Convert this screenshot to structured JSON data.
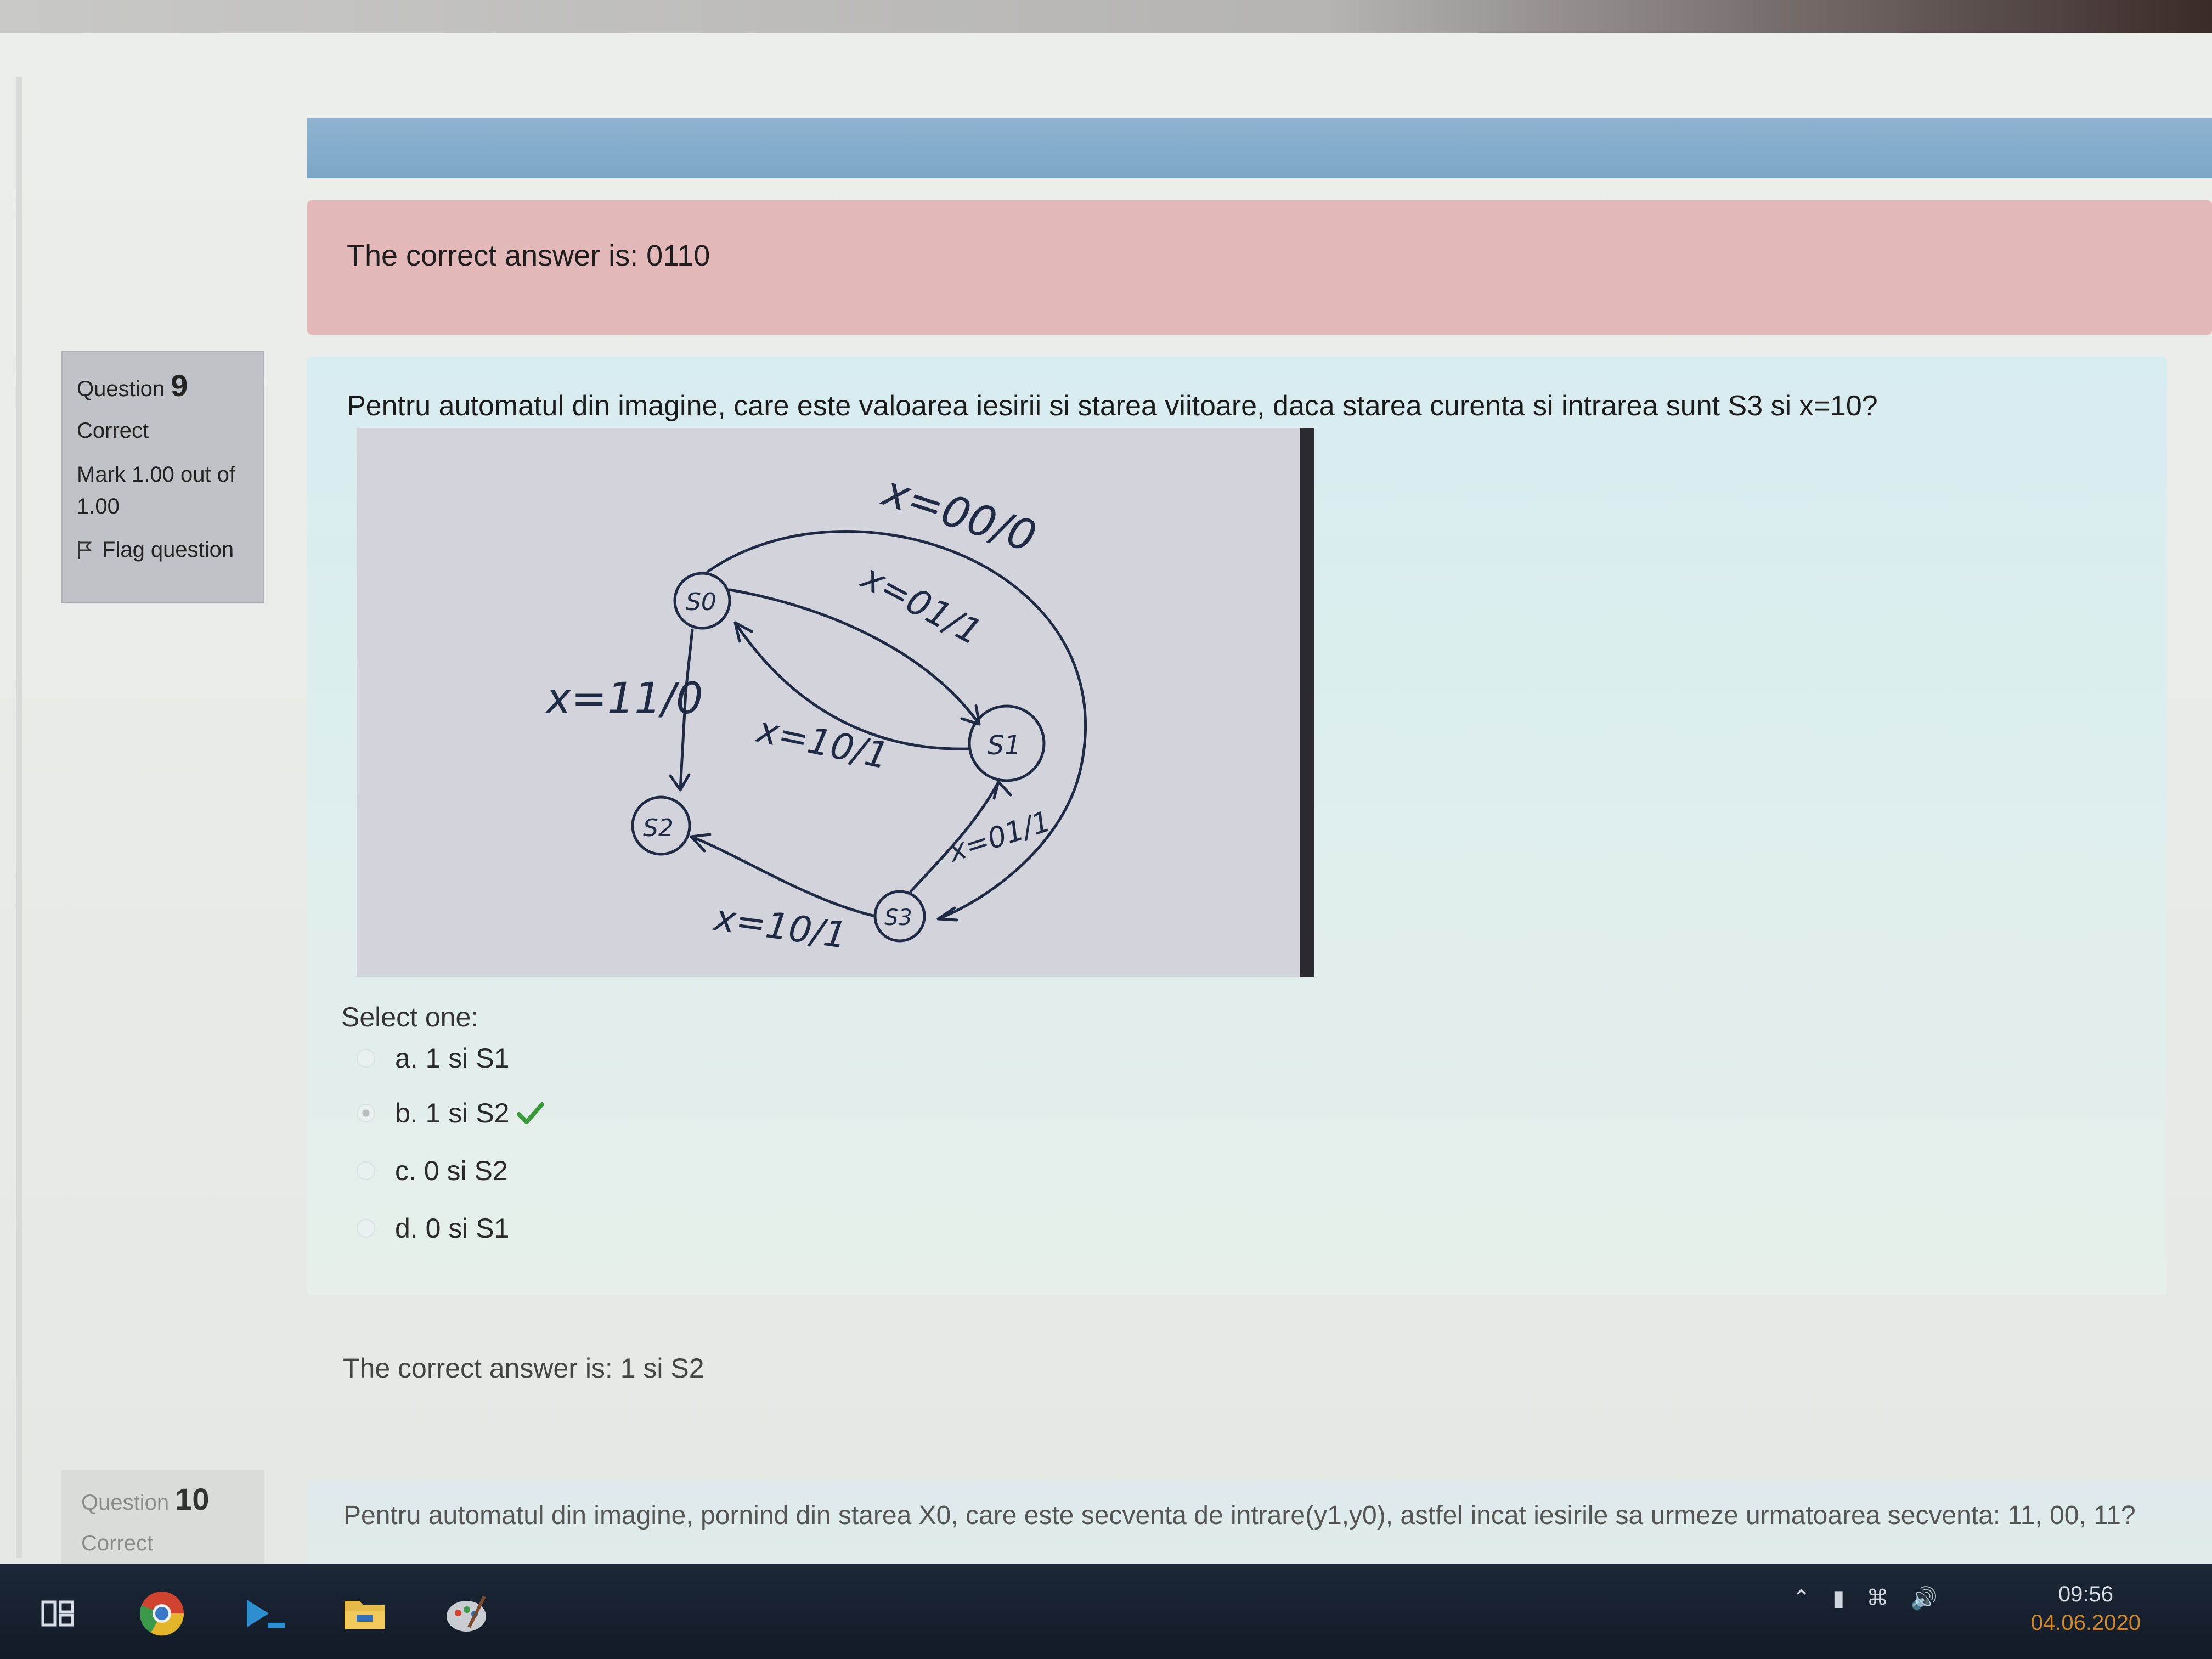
{
  "feedback_previous": {
    "text": "The correct answer is: 0110"
  },
  "question9": {
    "label": "Question",
    "number": "9",
    "status": "Correct",
    "mark": "Mark 1.00 out of 1.00",
    "flag_label": "Flag question",
    "text": "Pentru automatul din imagine, care este valoarea iesirii si starea viitoare, daca starea curenta si intrarea sunt S3 si x=10?",
    "select_label": "Select one:",
    "options": [
      {
        "label": "a. 1 si S1",
        "selected": false
      },
      {
        "label": "b. 1 si S2",
        "selected": true,
        "correct": true
      },
      {
        "label": "c. 0 si S2",
        "selected": false
      },
      {
        "label": "d. 0 si S1",
        "selected": false
      }
    ],
    "correct_answer": "The correct answer is: 1 si S2",
    "diagram": {
      "states": [
        "S0",
        "S1",
        "S2",
        "S3"
      ],
      "labels": [
        "x=00/0",
        "x=01/1",
        "x=11/0",
        "x=10/1",
        "x=01/1",
        "x=10/1"
      ]
    }
  },
  "question10": {
    "label": "Question",
    "number": "10",
    "status": "Correct",
    "text": "Pentru automatul din imagine, pornind din starea X0, care este secventa de intrare(y1,y0), astfel incat iesirile sa urmeze urmatoarea secventa: 11, 00, 11?"
  },
  "taskbar": {
    "time": "09:56",
    "date": "04.06.2020",
    "icons": [
      "task-view-icon",
      "chrome-icon",
      "terminal-icon",
      "file-explorer-icon",
      "paint-icon"
    ]
  },
  "colors": {
    "feedback_bg": "#e3b8b9",
    "content_bg": "#d7ecef",
    "accent_blue": "#7ba6c8",
    "check_green": "#3a9a3a",
    "taskbar_bg": "#1c2838"
  }
}
